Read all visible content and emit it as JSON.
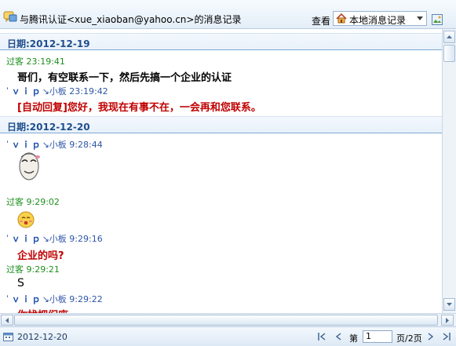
{
  "header": {
    "title": "与腾讯认证<xue_xiaoban@yahoo.cn>的消息记录",
    "view_label": "查看",
    "source_select": {
      "selected": "本地消息记录"
    }
  },
  "history": {
    "days": [
      {
        "date_label": "日期:2012-12-19",
        "entries": [
          {
            "sender_type": "guest",
            "sender": "过客",
            "time": "23:19:41",
            "text": "哥们，有空联系一下，然后先搞一个企业的认证",
            "color": "black"
          },
          {
            "sender_type": "vip",
            "sender_prefix": "ʹ",
            "sender": "ｖｉｐ",
            "sender_suffix": "↘小板",
            "time": "23:19:42",
            "text": "[自动回复]您好，我现在有事不在，一会再和您联系。",
            "color": "red"
          }
        ]
      },
      {
        "date_label": "日期:2012-12-20",
        "entries": [
          {
            "sender_type": "vip",
            "sender_prefix": "ʹ",
            "sender": "ｖｉｐ",
            "sender_suffix": "↘小板",
            "time": "9:28:44",
            "emoticon": "meme-face"
          },
          {
            "sender_type": "guest",
            "sender": "过客",
            "time": "9:29:02",
            "emoticon": "smiley-face"
          },
          {
            "sender_type": "vip",
            "sender_prefix": "ʹ",
            "sender": "ｖｉｐ",
            "sender_suffix": "↘小板",
            "time": "9:29:16",
            "text": "企业的吗?",
            "color": "red"
          },
          {
            "sender_type": "guest",
            "sender": "过客",
            "time": "9:29:21",
            "text": "S",
            "color": "black"
          },
          {
            "sender_type": "vip",
            "sender_prefix": "ʹ",
            "sender": "ｖｉｐ",
            "sender_suffix": "↘小板",
            "time": "9:29:22",
            "text": "你找杷们座",
            "color": "red"
          }
        ]
      }
    ]
  },
  "footer": {
    "current_date": "2012-12-20",
    "page_prefix": "第",
    "page_value": "1",
    "page_suffix": "页/2页"
  },
  "colors": {
    "guest_name": "#1d8f1d",
    "vip_name": "#1b4cad",
    "date_text": "#1f4e8c",
    "auto_reply": "#c00000"
  }
}
